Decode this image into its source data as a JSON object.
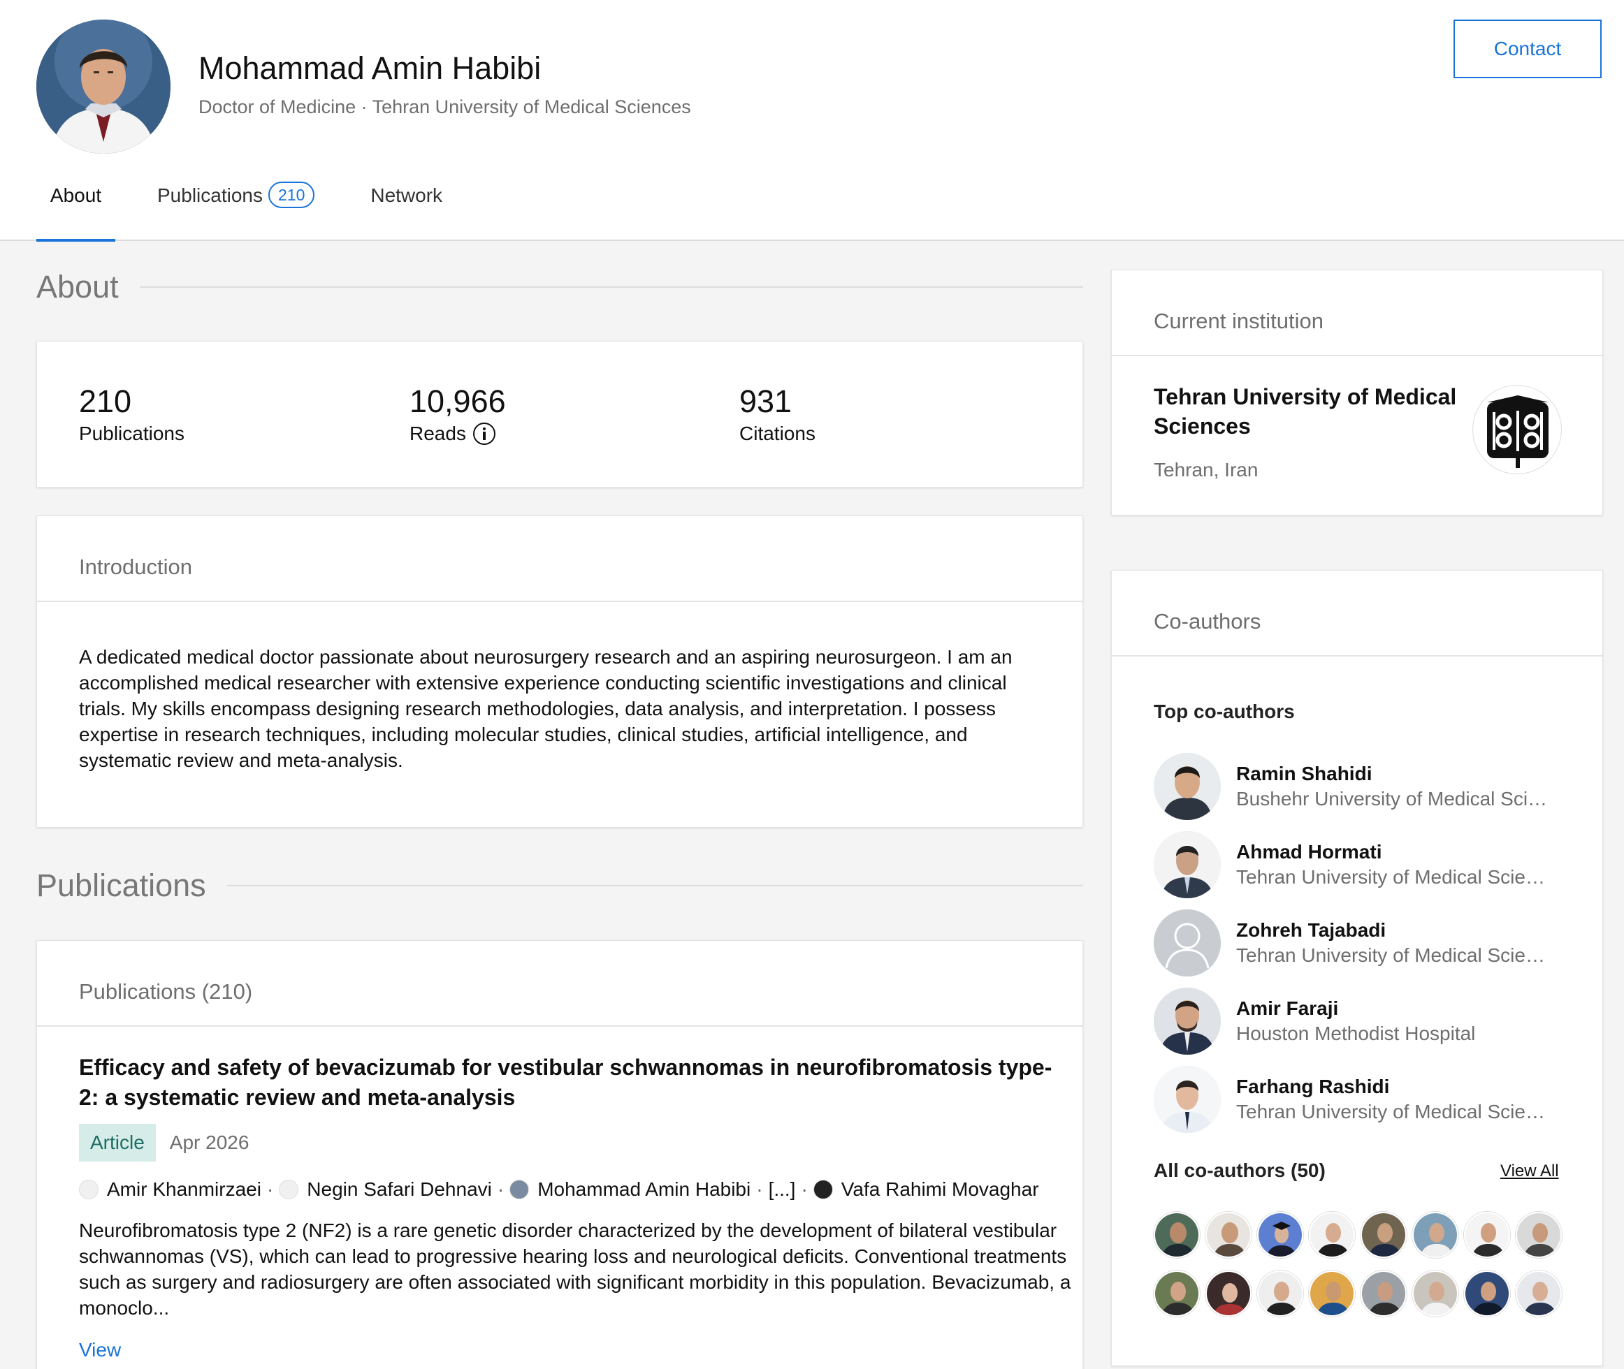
{
  "profile": {
    "name": "Mohammad Amin Habibi",
    "subtitle": "Doctor of Medicine · Tehran University of Medical Sciences",
    "contact_label": "Contact"
  },
  "tabs": {
    "about": "About",
    "publications": "Publications",
    "publications_count": "210",
    "network": "Network"
  },
  "about_section": {
    "heading": "About",
    "stats": [
      {
        "value": "210",
        "label": "Publications"
      },
      {
        "value": "10,966",
        "label": "Reads"
      },
      {
        "value": "931",
        "label": "Citations"
      }
    ],
    "intro_heading": "Introduction",
    "intro_text": "A dedicated medical doctor passionate about neurosurgery research and an aspiring neurosurgeon. I am an accomplished medical researcher with extensive experience conducting scientific investigations and clinical trials. My skills encompass designing research methodologies, data analysis, and interpretation. I possess expertise in research techniques, including molecular studies, clinical studies, artificial intelligence, and systematic review and meta-analysis."
  },
  "publications_section": {
    "heading": "Publications",
    "card_heading": "Publications (210)",
    "items": [
      {
        "title": "Efficacy and safety of bevacizumab for vestibular schwannomas in neurofibromatosis type-2: a systematic review and meta-analysis",
        "type": "Article",
        "date": "Apr 2026",
        "authors": [
          "Amir Khanmirzaei",
          "Negin Safari Dehnavi",
          "Mohammad Amin Habibi",
          "[...]",
          "Vafa Rahimi Movaghar"
        ],
        "separator": "·",
        "abstract": "Neurofibromatosis type 2 (NF2) is a rare genetic disorder characterized by the development of bilateral vestibular schwannomas (VS), which can lead to progressive hearing loss and neurological deficits. Conventional treatments such as surgery and radiosurgery are often associated with significant morbidity in this population. Bevacizumab, a monoclo...",
        "view_label": "View"
      }
    ]
  },
  "institution": {
    "heading": "Current institution",
    "name": "Tehran University of Medical Sciences",
    "location": "Tehran, Iran"
  },
  "coauthors": {
    "heading": "Co-authors",
    "top_label": "Top co-authors",
    "top": [
      {
        "name": "Ramin Shahidi",
        "affiliation": "Bushehr University of Medical Sciences"
      },
      {
        "name": "Ahmad Hormati",
        "affiliation": "Tehran University of Medical Sciences"
      },
      {
        "name": "Zohreh Tajabadi",
        "affiliation": "Tehran University of Medical Sciences"
      },
      {
        "name": "Amir Faraji",
        "affiliation": "Houston Methodist Hospital"
      },
      {
        "name": "Farhang Rashidi",
        "affiliation": "Tehran University of Medical Sciences"
      }
    ],
    "all_label": "All co-authors (50)",
    "view_all_label": "View All"
  },
  "colors": {
    "accent": "#1a73d9",
    "article_badge_bg": "#d6ece9",
    "article_badge_text": "#1c6e63",
    "muted_text": "#6e6e6e",
    "page_bg": "#f4f4f4"
  }
}
